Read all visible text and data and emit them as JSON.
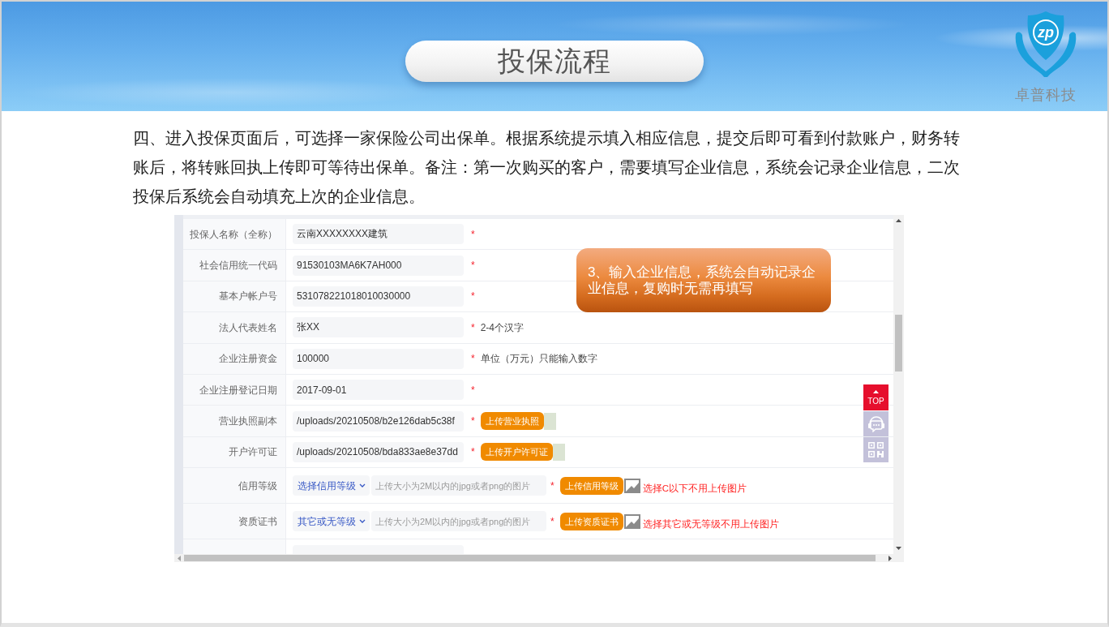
{
  "header": {
    "title": "投保流程",
    "logo": {
      "mark": "zp",
      "name": "卓普科技"
    }
  },
  "intro": "四、进入投保页面后，可选择一家保险公司出保单。根据系统提示填入相应信息，提交后即可看到付款账户，财务转账后，将转账回执上传即可等待出保单。备注：第一次购买的客户，需要填写企业信息，系统会记录企业信息，二次投保后系统会自动填充上次的企业信息。",
  "form_screenshot": {
    "rows": [
      {
        "kind": "text",
        "label": "投保人名称（全称）",
        "value": "云南XXXXXXXX建筑",
        "required_mark": "*"
      },
      {
        "kind": "text",
        "label": "社会信用统一代码",
        "value": "91530103MA6K7AH000",
        "required_mark": "*"
      },
      {
        "kind": "text",
        "label": "基本户帐户号",
        "value": "531078221018010030000",
        "required_mark": "*"
      },
      {
        "kind": "text",
        "label": "法人代表姓名",
        "value": "张XX",
        "required_mark": "*",
        "hint": "2-4个汉字"
      },
      {
        "kind": "text",
        "label": "企业注册资金",
        "value": "100000",
        "required_mark": "*",
        "hint": "单位（万元）只能输入数字"
      },
      {
        "kind": "text",
        "label": "企业注册登记日期",
        "value": "2017-09-01",
        "required_mark": "*"
      },
      {
        "kind": "upload",
        "label": "营业执照副本",
        "value": "/uploads/20210508/b2e126dab5c38f",
        "required_mark": "*",
        "button": "上传营业执照",
        "uploaded": true
      },
      {
        "kind": "upload",
        "label": "开户许可证",
        "value": "/uploads/20210508/bda833ae8e37dd",
        "required_mark": "*",
        "button": "上传开户许可证",
        "uploaded": true
      },
      {
        "kind": "grade",
        "label": "信用等级",
        "select": "选择信用等级",
        "placeholder": "上传大小为2M以内的jpg或者png的图片",
        "required_mark": "*",
        "button": "上传信用等级",
        "uploaded": false,
        "note": "选择C以下不用上传图片"
      },
      {
        "kind": "grade",
        "label": "资质证书",
        "select": "其它或无等级",
        "placeholder": "上传大小为2M以内的jpg或者png的图片",
        "required_mark": "*",
        "button": "上传资质证书",
        "uploaded": false,
        "note": "选择其它或无等级不用上传图片"
      }
    ],
    "callout": "3、输入企业信息，系统会自动记录企业信息，复购时无需再填写",
    "side_buttons": [
      {
        "kind": "top",
        "label": "TOP"
      },
      {
        "kind": "support"
      },
      {
        "kind": "qr"
      }
    ]
  }
}
